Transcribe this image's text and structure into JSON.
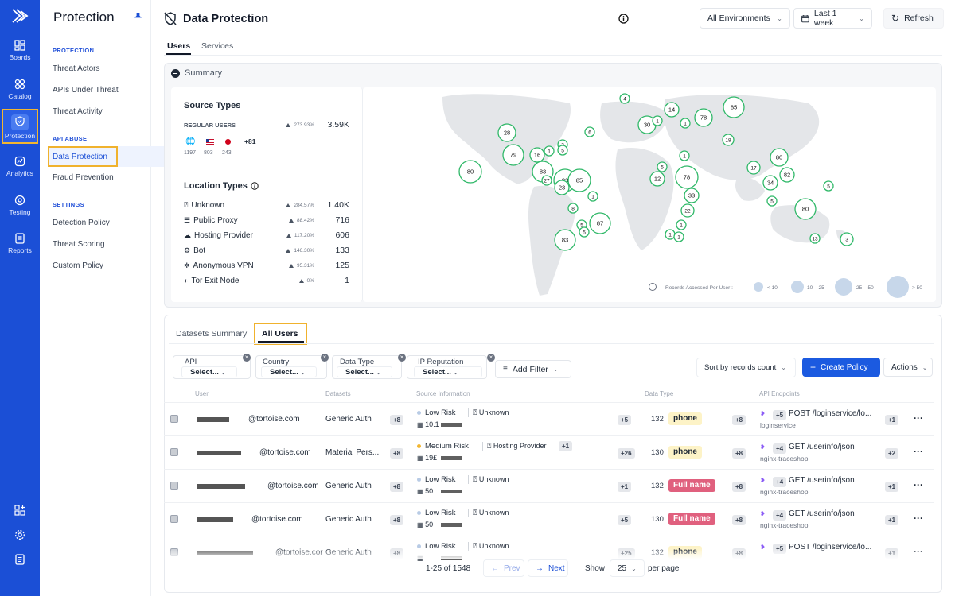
{
  "rail": {
    "items": [
      {
        "label": "Boards",
        "icon": "boards-icon"
      },
      {
        "label": "Catalog",
        "icon": "catalog-icon"
      },
      {
        "label": "Protection",
        "icon": "shield-icon"
      },
      {
        "label": "Analytics",
        "icon": "analytics-icon"
      },
      {
        "label": "Testing",
        "icon": "testing-icon"
      },
      {
        "label": "Reports",
        "icon": "reports-icon"
      }
    ]
  },
  "sidebar": {
    "title": "Protection",
    "sections": [
      {
        "title": "PROTECTION",
        "items": [
          "Threat Actors",
          "APIs Under Threat",
          "Threat Activity"
        ]
      },
      {
        "title": "API ABUSE",
        "items": [
          "Data Protection",
          "Fraud Prevention"
        ]
      },
      {
        "title": "SETTINGS",
        "items": [
          "Detection Policy",
          "Threat Scoring",
          "Custom Policy"
        ]
      }
    ]
  },
  "header": {
    "title": "Data Protection",
    "environment": "All Environments",
    "range": "Last 1 week",
    "refresh": "Refresh"
  },
  "tabs": [
    "Users",
    "Services"
  ],
  "summary": {
    "label": "Summary",
    "source_types_title": "Source Types",
    "regular_users_label": "REGULAR USERS",
    "regular_users_pct": "273.93%",
    "regular_users_value": "3.59K",
    "countries": [
      {
        "flag": "other",
        "count": "1197"
      },
      {
        "flag": "us",
        "count": "803"
      },
      {
        "flag": "jp",
        "count": "243"
      }
    ],
    "more_countries": "+81",
    "location_types_title": "Location Types",
    "location_types": [
      {
        "label": "Unknown",
        "pct": "284.57%",
        "value": "1.40K"
      },
      {
        "label": "Public Proxy",
        "pct": "88.42%",
        "value": "716"
      },
      {
        "label": "Hosting Provider",
        "pct": "117.20%",
        "value": "606"
      },
      {
        "label": "Bot",
        "pct": "146.30%",
        "value": "133"
      },
      {
        "label": "Anonymous VPN",
        "pct": "95.31%",
        "value": "125"
      },
      {
        "label": "Tor Exit Node",
        "pct": "0%",
        "value": "1"
      }
    ],
    "legend_title": "Records Accessed Per User :",
    "legend_items": [
      "< 10",
      "10 – 25",
      "25 – 50",
      "> 50"
    ]
  },
  "map_bubbles": [
    "4",
    "85",
    "14",
    "30",
    "78",
    "1",
    "1",
    "28",
    "6",
    "3",
    "79",
    "16",
    "5",
    "1",
    "18",
    "83",
    "1",
    "83",
    "80",
    "80",
    "85",
    "27",
    "23",
    "12",
    "78",
    "17",
    "5",
    "34",
    "82",
    "5",
    "33",
    "8",
    "1",
    "22",
    "87",
    "5",
    "1",
    "1",
    "80",
    "83",
    "1",
    "13",
    "3",
    "5",
    "5"
  ],
  "list_tabs": [
    "Datasets Summary",
    "All Users"
  ],
  "filters": [
    {
      "label": "API",
      "value": "Select..."
    },
    {
      "label": "Country",
      "value": "Select..."
    },
    {
      "label": "Data Type",
      "value": "Select..."
    },
    {
      "label": "IP Reputation",
      "value": "Select..."
    }
  ],
  "add_filter": "Add Filter",
  "sort": "Sort by records count",
  "create_policy": "Create Policy",
  "actions": "Actions",
  "columns": [
    "User",
    "Datasets",
    "Source Information",
    "Data Type",
    "API Endpoints"
  ],
  "rows": [
    {
      "user": "@tortoise.com",
      "dataset": "Generic Auth",
      "dataset_more": "+8",
      "risk": "Low Risk",
      "location": "Unknown",
      "location_more": "",
      "ip": "10.1",
      "src_more": "+5",
      "records": "132",
      "dtype": "phone",
      "dtype_color": "#fdf3c7",
      "dtype_text": "#1f2937",
      "dtype_more": "+8",
      "api_more": "+5",
      "method": "POST",
      "path": "/loginservice/lo...",
      "service": "loginservice",
      "ep_more": "+1"
    },
    {
      "user": "@tortoise.com",
      "dataset": "Material Pers...",
      "dataset_more": "+8",
      "risk": "Medium Risk",
      "location": "Hosting Provider",
      "location_more": "+1",
      "ip": "19£",
      "src_more": "+26",
      "records": "130",
      "dtype": "phone",
      "dtype_color": "#fdf3c7",
      "dtype_text": "#1f2937",
      "dtype_more": "+8",
      "api_more": "+4",
      "method": "GET",
      "path": "/userinfo/json",
      "service": "nginx-traceshop",
      "ep_more": "+2"
    },
    {
      "user": "@tortoise.com",
      "dataset": "Generic Auth",
      "dataset_more": "+8",
      "risk": "Low Risk",
      "location": "Unknown",
      "location_more": "",
      "ip": "50.",
      "src_more": "+1",
      "records": "132",
      "dtype": "Full name",
      "dtype_color": "#e0607e",
      "dtype_text": "#ffffff",
      "dtype_more": "+8",
      "api_more": "+4",
      "method": "GET",
      "path": "/userinfo/json",
      "service": "nginx-traceshop",
      "ep_more": "+1"
    },
    {
      "user": "@tortoise.com",
      "dataset": "Generic Auth",
      "dataset_more": "+8",
      "risk": "Low Risk",
      "location": "Unknown",
      "location_more": "",
      "ip": "50",
      "src_more": "+5",
      "records": "130",
      "dtype": "Full name",
      "dtype_color": "#e0607e",
      "dtype_text": "#ffffff",
      "dtype_more": "+8",
      "api_more": "+4",
      "method": "GET",
      "path": "/userinfo/json",
      "service": "nginx-traceshop",
      "ep_more": "+1"
    },
    {
      "user": "@tortoise.cor",
      "dataset": "Generic Auth",
      "dataset_more": "+8",
      "risk": "Low Risk",
      "location": "Unknown",
      "location_more": "",
      "ip": "",
      "src_more": "+25",
      "records": "132",
      "dtype": "phone",
      "dtype_color": "#fdf3c7",
      "dtype_text": "#1f2937",
      "dtype_more": "+8",
      "api_more": "+5",
      "method": "POST",
      "path": "/loginservice/lo...",
      "service": "",
      "ep_more": "+1"
    }
  ],
  "pagination": {
    "range": "1-25 of 1548",
    "prev": "Prev",
    "next": "Next",
    "show": "Show",
    "per_page_value": "25",
    "per_page": "per page"
  }
}
